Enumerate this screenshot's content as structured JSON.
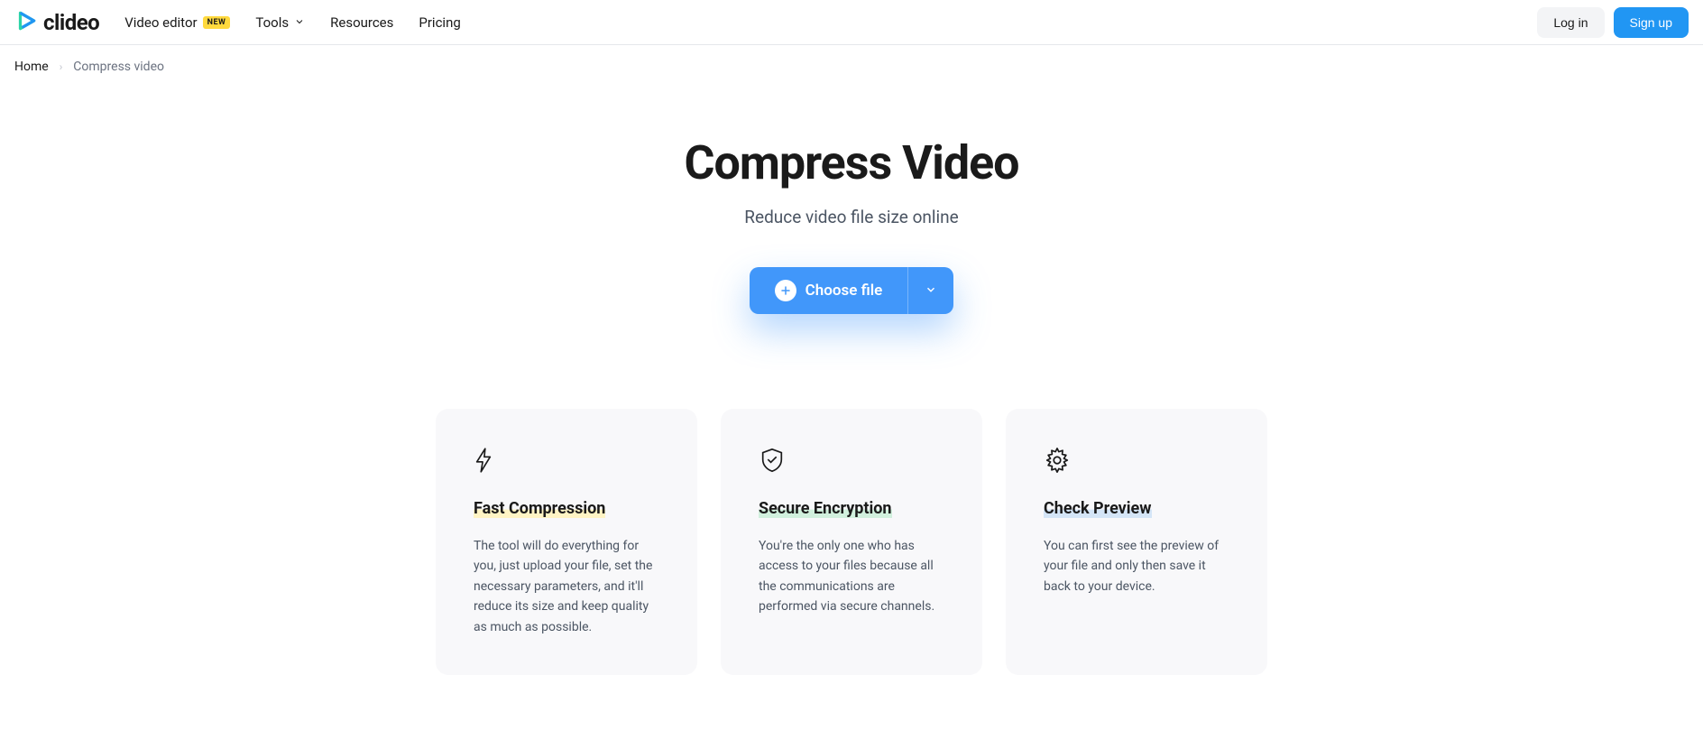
{
  "header": {
    "logo_text": "clideo",
    "nav": {
      "video_editor": "Video editor",
      "video_editor_badge": "NEW",
      "tools": "Tools",
      "resources": "Resources",
      "pricing": "Pricing"
    },
    "login": "Log in",
    "signup": "Sign up"
  },
  "breadcrumb": {
    "home": "Home",
    "current": "Compress video"
  },
  "hero": {
    "title": "Compress Video",
    "subtitle": "Reduce video file size online",
    "choose_file": "Choose file"
  },
  "features": [
    {
      "icon": "lightning-icon",
      "title": "Fast Compression",
      "highlight": "yellow",
      "desc": "The tool will do everything for you, just upload your file, set the necessary parameters, and it'll reduce its size and keep quality as much as possible."
    },
    {
      "icon": "shield-icon",
      "title": "Secure Encryption",
      "highlight": "green",
      "desc": "You're the only one who has access to your files because all the communications are performed via secure channels."
    },
    {
      "icon": "gear-icon",
      "title": "Check Preview",
      "highlight": "blue",
      "desc": "You can first see the preview of your file and only then save it back to your device."
    }
  ]
}
